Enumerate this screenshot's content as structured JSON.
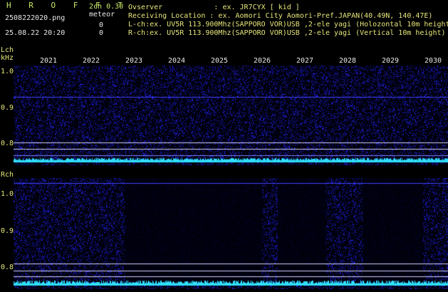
{
  "header": {
    "app_title": "H R O F F T",
    "version": "2ch 0.30",
    "filename": "2508222020.png",
    "meteor_label": "meteor",
    "datetime": "25.08.22 20:20",
    "l_count": "0",
    "r_count": "0",
    "observer_line": "Ovserver            : ex. JR7CYX [ kid ]",
    "location_line": "Receiving Location : ex. Aomori City Aomori-Pref.JAPAN(40.49N, 140.47E)",
    "lch_line": "L-ch:ex. UV5R 113.900Mhz(SAPPORO VOR)USB ,2-ele yagi (Holozontal 10m height)",
    "rch_line": "R-ch:ex. UV5R 113.900Mhz(SAPPORO VOR)USB ,2-ele yagi (Vertical 10m height)"
  },
  "lch_panel": {
    "channel_label": "Lch",
    "unit_label": "kHz",
    "y_ticks": [
      "1.0",
      "0.9",
      "0.8"
    ],
    "x_ticks": [
      "2021",
      "2022",
      "2023",
      "2024",
      "2025",
      "2026",
      "2027",
      "2028",
      "2029",
      "2030"
    ]
  },
  "rch_panel": {
    "channel_label": "Rch",
    "y_ticks": [
      "1.0",
      "0.9",
      "0.8"
    ]
  },
  "colors": {
    "label_yellow": "#e6e67a",
    "title_green": "#c8e86a",
    "noise_blue": "#3030ff",
    "trace_cyan": "#30e0ff",
    "hline_white": "#d0d0ff"
  }
}
